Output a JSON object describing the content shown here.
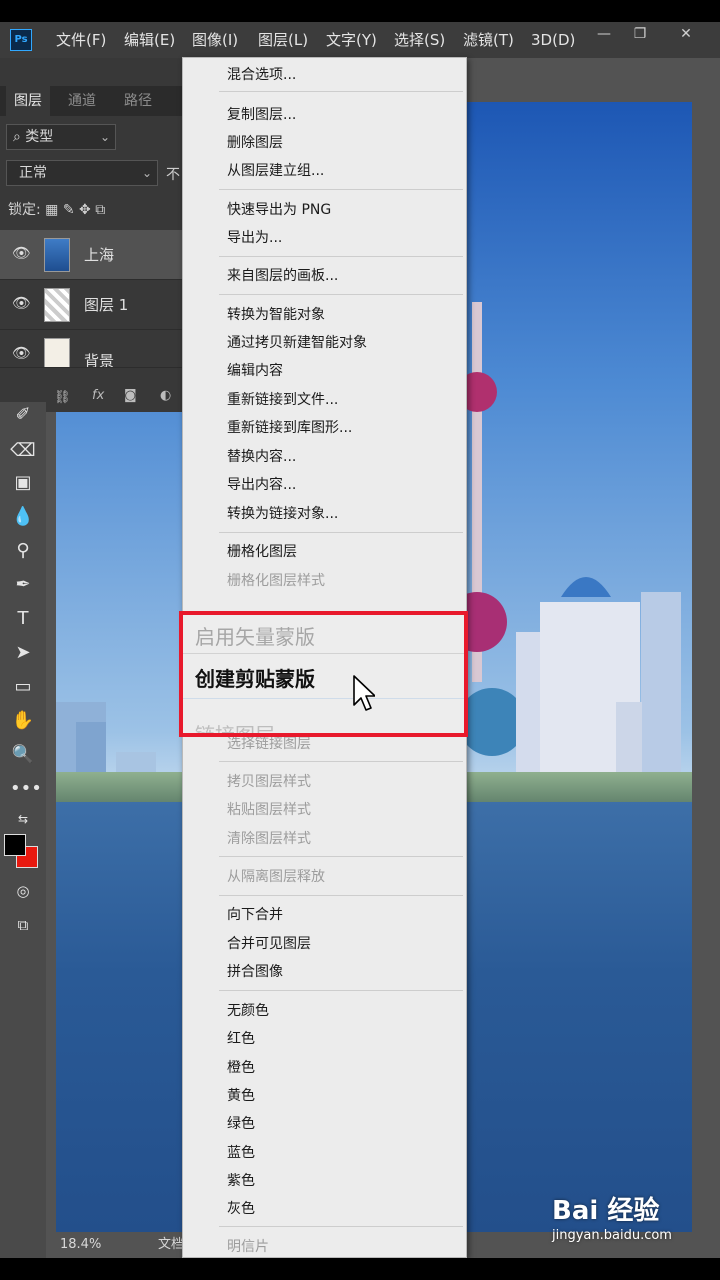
{
  "app": {
    "logo": "Ps",
    "menus": [
      "文件(F)",
      "编辑(E)",
      "图像(I)",
      "图层(L)",
      "文字(Y)",
      "选择(S)",
      "滤镜(T)",
      "3D(D)"
    ],
    "window_controls": {
      "minimize": "—",
      "restore": "❐",
      "close": "✕"
    }
  },
  "layers_panel": {
    "tabs": [
      "图层",
      "通道",
      "路径"
    ],
    "filter_label": "类型",
    "blend_mode": "正常",
    "opacity_label": "不",
    "lock_label": "锁定:",
    "layers": [
      {
        "name": "上海",
        "selected": true
      },
      {
        "name": "图层 1",
        "selected": false
      },
      {
        "name": "背景",
        "selected": false
      }
    ],
    "footer_fx": "fx"
  },
  "status": {
    "zoom": "18.4%",
    "doc_label": "文档"
  },
  "context_menu": {
    "groups": [
      [
        {
          "label": "混合选项...",
          "disabled": false
        }
      ],
      [
        {
          "label": "复制图层...",
          "disabled": false
        },
        {
          "label": "删除图层",
          "disabled": false
        },
        {
          "label": "从图层建立组...",
          "disabled": false
        }
      ],
      [
        {
          "label": "快速导出为 PNG",
          "disabled": false
        },
        {
          "label": "导出为...",
          "disabled": false
        }
      ],
      [
        {
          "label": "来自图层的画板...",
          "disabled": false
        }
      ],
      [
        {
          "label": "转换为智能对象",
          "disabled": false
        },
        {
          "label": "通过拷贝新建智能对象",
          "disabled": false
        },
        {
          "label": "编辑内容",
          "disabled": false
        },
        {
          "label": "重新链接到文件...",
          "disabled": false
        },
        {
          "label": "重新链接到库图形...",
          "disabled": false
        },
        {
          "label": "替换内容...",
          "disabled": false
        },
        {
          "label": "导出内容...",
          "disabled": false
        },
        {
          "label": "转换为链接对象...",
          "disabled": false
        }
      ],
      [
        {
          "label": "栅格化图层",
          "disabled": false
        },
        {
          "label": "栅格化图层样式",
          "disabled": true
        }
      ]
    ],
    "highlight": {
      "items": [
        {
          "label": "启用矢量蒙版",
          "disabled": true
        },
        {
          "label": "创建剪贴蒙版",
          "disabled": false
        }
      ],
      "clipped_label": "链接图层"
    },
    "lower_groups": [
      [
        {
          "label": "选择链接图层",
          "disabled": true
        }
      ],
      [
        {
          "label": "拷贝图层样式",
          "disabled": true
        },
        {
          "label": "粘贴图层样式",
          "disabled": true
        },
        {
          "label": "清除图层样式",
          "disabled": true
        }
      ],
      [
        {
          "label": "从隔离图层释放",
          "disabled": true
        }
      ],
      [
        {
          "label": "向下合并",
          "disabled": false
        },
        {
          "label": "合并可见图层",
          "disabled": false
        },
        {
          "label": "拼合图像",
          "disabled": false
        }
      ],
      [
        {
          "label": "无颜色",
          "disabled": false
        },
        {
          "label": "红色",
          "disabled": false
        },
        {
          "label": "橙色",
          "disabled": false
        },
        {
          "label": "黄色",
          "disabled": false
        },
        {
          "label": "绿色",
          "disabled": false
        },
        {
          "label": "蓝色",
          "disabled": false
        },
        {
          "label": "紫色",
          "disabled": false
        },
        {
          "label": "灰色",
          "disabled": false
        }
      ],
      [
        {
          "label": "明信片",
          "disabled": true
        }
      ]
    ]
  },
  "watermark": {
    "brand": "Bai 经验",
    "url": "jingyan.baidu.com"
  },
  "colors": {
    "highlight_border": "#e8192c",
    "foreground": "#000000",
    "background": "#e8190f"
  }
}
